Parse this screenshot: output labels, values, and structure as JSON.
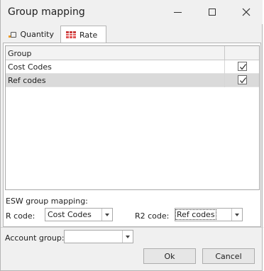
{
  "window": {
    "title": "Group mapping"
  },
  "tabs": [
    {
      "label": "Quantity",
      "icon": "quantity-icon",
      "active": false
    },
    {
      "label": "Rate",
      "icon": "rate-grid-icon",
      "active": true
    }
  ],
  "grid": {
    "header": "Group",
    "rows": [
      {
        "name": "Cost Codes",
        "checked": true,
        "selected": false
      },
      {
        "name": "Ref codes",
        "checked": true,
        "selected": true
      }
    ]
  },
  "mapping": {
    "section_label": "ESW group mapping:",
    "r_code_label": "R code:",
    "r_code_value": "Cost Codes",
    "r2_code_label": "R2 code:",
    "r2_code_value": "Ref codes"
  },
  "account": {
    "label": "Account group:",
    "value": ""
  },
  "buttons": {
    "ok": "Ok",
    "cancel": "Cancel"
  },
  "colors": {
    "background": "#f0f0f0",
    "selected_row": "#dadada",
    "rate_icon": "#e05555",
    "quantity_icon_accent": "#e89a2a"
  }
}
